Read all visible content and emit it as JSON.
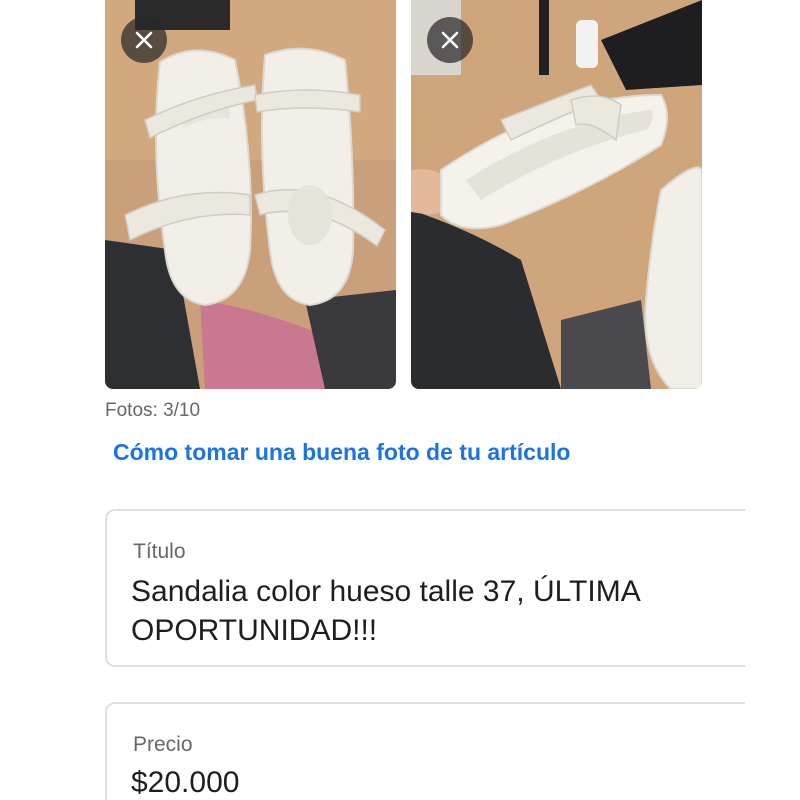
{
  "photos": [
    {
      "alt": "sandalias blancas vista superior",
      "remove_icon": "close-icon"
    },
    {
      "alt": "sandalia blanca vista lateral",
      "remove_icon": "close-icon"
    }
  ],
  "photo_counter": "Fotos: 3/10",
  "tips_link": "Cómo tomar una buena foto de tu artículo",
  "title_field": {
    "label": "Título",
    "value": "Sandalia color hueso talle 37, ÚLTIMA OPORTUNIDAD!!!"
  },
  "price_field": {
    "label": "Precio",
    "value": "$20.000"
  },
  "colors": {
    "link": "#1b74e4",
    "label": "#65676b",
    "text": "#1c1e21",
    "border": "#dddfe2"
  }
}
